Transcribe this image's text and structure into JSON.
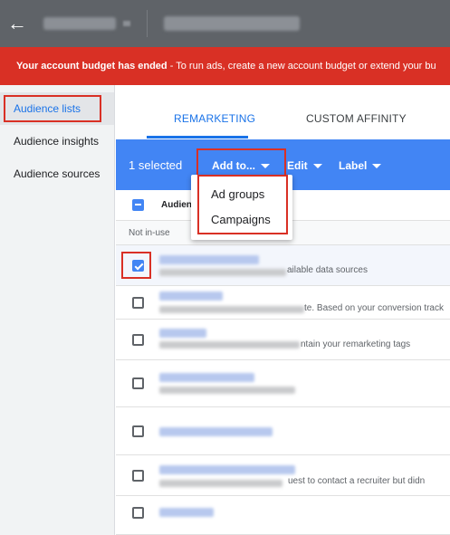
{
  "appbar": {
    "back_icon": "arrow-left-icon"
  },
  "banner": {
    "bold_text": "Your account budget has ended",
    "text": " - To run ads, create a new account budget or extend your bu"
  },
  "sidebar": {
    "items": [
      {
        "label": "Audience lists"
      },
      {
        "label": "Audience insights"
      },
      {
        "label": "Audience sources"
      }
    ]
  },
  "tabs": [
    {
      "label": "REMARKETING"
    },
    {
      "label": "CUSTOM AFFINITY"
    }
  ],
  "selection_bar": {
    "count_label": "1 selected",
    "add_to_label": "Add to...",
    "edit_label": "Edit",
    "label_label": "Label"
  },
  "table": {
    "header": "Audien",
    "group_label": "Not in-use",
    "rows": [
      {
        "checked": true,
        "desc_visible": "ailable data sources"
      },
      {
        "checked": false,
        "desc_visible": "te. Based on your conversion track"
      },
      {
        "checked": false,
        "desc_visible": "ntain your remarketing tags"
      },
      {
        "checked": false,
        "desc_visible": ""
      },
      {
        "checked": false,
        "desc_visible": ""
      },
      {
        "checked": false,
        "desc_visible": "uest to contact a recruiter but didn"
      },
      {
        "checked": false,
        "desc_visible": ""
      }
    ]
  },
  "menu": {
    "items": [
      {
        "label": "Ad groups"
      },
      {
        "label": "Campaigns"
      }
    ]
  },
  "colors": {
    "appbar": "#5f6368",
    "banner": "#d93025",
    "accent": "#1a73e8",
    "selection_bar": "#4285f4",
    "highlight": "#d93025"
  }
}
